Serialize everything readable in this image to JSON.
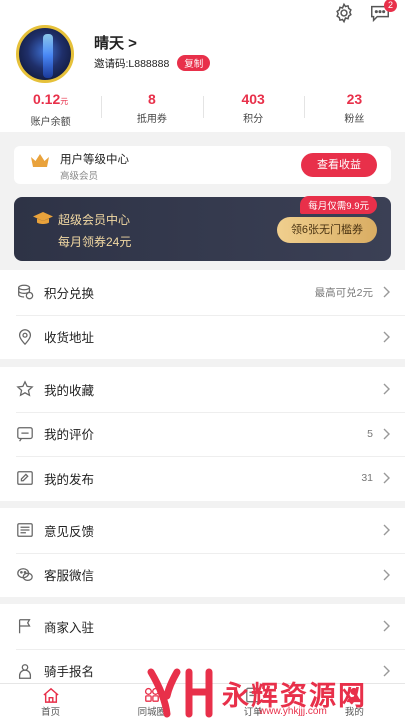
{
  "user": {
    "name": "晴天 >",
    "invite_label": "邀请码:L888888",
    "copy_label": "复制"
  },
  "notifications": {
    "count": "2"
  },
  "stats": [
    {
      "value": "0.12",
      "unit": "元",
      "label": "账户余额"
    },
    {
      "value": "8",
      "unit": "",
      "label": "抵用券"
    },
    {
      "value": "403",
      "unit": "",
      "label": "积分"
    },
    {
      "value": "23",
      "unit": "",
      "label": "粉丝"
    }
  ],
  "level_card": {
    "title": "用户等级中心",
    "subtitle": "高级会员",
    "button": "查看收益"
  },
  "vip_card": {
    "title": "超级会员中心",
    "subtitle": "每月领券24元",
    "price_tag": "每月仅需9.9元",
    "button": "领6张无门槛券"
  },
  "menu_groups": [
    [
      {
        "label": "积分兑换",
        "value": "最高可兑2元",
        "icon": "coins-icon"
      },
      {
        "label": "收货地址",
        "value": "",
        "icon": "location-icon"
      }
    ],
    [
      {
        "label": "我的收藏",
        "value": "",
        "icon": "star-icon"
      },
      {
        "label": "我的评价",
        "value": "5",
        "icon": "comment-icon"
      },
      {
        "label": "我的发布",
        "value": "31",
        "icon": "edit-icon"
      }
    ],
    [
      {
        "label": "意见反馈",
        "value": "",
        "icon": "feedback-icon"
      },
      {
        "label": "客服微信",
        "value": "",
        "icon": "wechat-icon"
      }
    ],
    [
      {
        "label": "商家入驻",
        "value": "",
        "icon": "flag-icon"
      },
      {
        "label": "骑手报名",
        "value": "",
        "icon": "rider-icon"
      }
    ]
  ],
  "tabs": [
    {
      "label": "首页",
      "icon": "home-icon"
    },
    {
      "label": "同城圈",
      "icon": "grid-icon"
    },
    {
      "label": "订单",
      "icon": "order-icon"
    },
    {
      "label": "我的",
      "icon": "user-icon"
    }
  ],
  "watermark": {
    "text": "永辉资源网",
    "url": "www.yhkjjj.com"
  },
  "colors": {
    "accent": "#e8304a",
    "gold": "#f2d9a3",
    "vip_bg": "#2e3346"
  }
}
